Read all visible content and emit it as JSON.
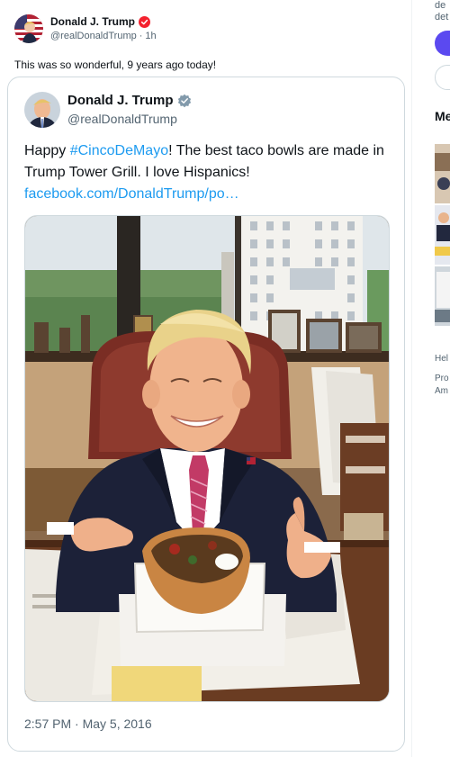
{
  "post": {
    "author_name": "Donald J. Trump",
    "handle": "@realDonaldTrump",
    "separator": "·",
    "time": "1h",
    "text": "This was so wonderful, 9 years ago today!"
  },
  "quoted": {
    "author_name": "Donald J. Trump",
    "handle": "@realDonaldTrump",
    "text_before": "Happy ",
    "hashtag": "#CincoDeMayo",
    "text_after": "! The best taco bowls are made in Trump Tower Grill. I love Hispanics!",
    "link": "facebook.com/DonaldTrump/po…",
    "timestamp": "2:57 PM · May 5, 2016"
  },
  "right_panel": {
    "top_fragment_1": "de",
    "top_fragment_2": "det",
    "heading_fragment": "Me",
    "footer_1": "Hel",
    "footer_2": "Pro",
    "footer_3": "Am"
  },
  "colors": {
    "link": "#1d9bf0",
    "verified_red": "#f4212e",
    "verified_gray": "#829aab",
    "accent_button": "#5b49f0",
    "muted_text": "#536471"
  }
}
